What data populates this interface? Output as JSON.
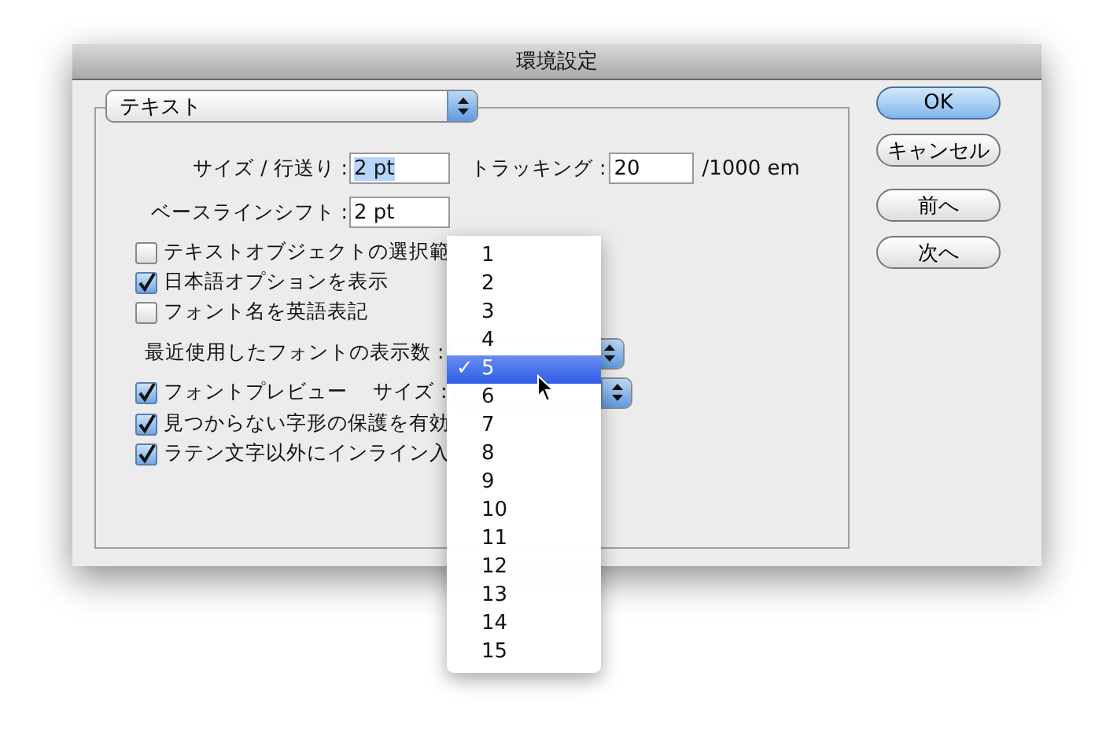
{
  "window": {
    "title": "環境設定"
  },
  "category_popup": {
    "value": "テキスト"
  },
  "size_row": {
    "label": "サイズ / 行送り :",
    "value": "2 pt",
    "value_selected": true,
    "tracking_label": "トラッキング :",
    "tracking_value": "20",
    "tracking_unit": "/1000 em"
  },
  "baseline_row": {
    "label": "ベースラインシフト :",
    "value": "2 pt",
    "value_selected": false
  },
  "checkboxes_top": [
    {
      "label": "テキストオブジェクトの選択範",
      "checked": false
    },
    {
      "label": "日本語オプションを表示",
      "checked": true
    },
    {
      "label": "フォント名を英語表記",
      "checked": false
    }
  ],
  "recent_fonts": {
    "label": "最近使用したフォントの表示数 :"
  },
  "font_preview": {
    "label": "フォントプレビュー",
    "checked": true,
    "size_label": "サイズ :"
  },
  "checkboxes_bottom": [
    {
      "label": "見つからない字形の保護を有効",
      "checked": true
    },
    {
      "label": "ラテン文字以外にインライン入",
      "checked": true
    }
  ],
  "menu": {
    "check_mark": "✓",
    "items": [
      {
        "label": "1",
        "selected": false
      },
      {
        "label": "2",
        "selected": false
      },
      {
        "label": "3",
        "selected": false
      },
      {
        "label": "4",
        "selected": false
      },
      {
        "label": "5",
        "selected": true
      },
      {
        "label": "6",
        "selected": false
      },
      {
        "label": "7",
        "selected": false
      },
      {
        "label": "8",
        "selected": false
      },
      {
        "label": "9",
        "selected": false
      },
      {
        "label": "10",
        "selected": false
      },
      {
        "label": "11",
        "selected": false
      },
      {
        "label": "12",
        "selected": false
      },
      {
        "label": "13",
        "selected": false
      },
      {
        "label": "14",
        "selected": false
      },
      {
        "label": "15",
        "selected": false
      }
    ]
  },
  "buttons": [
    {
      "label": "OK",
      "default": true
    },
    {
      "label": "キャンセル",
      "default": false
    },
    {
      "label": "前へ",
      "default": false
    },
    {
      "label": "次へ",
      "default": false
    }
  ]
}
